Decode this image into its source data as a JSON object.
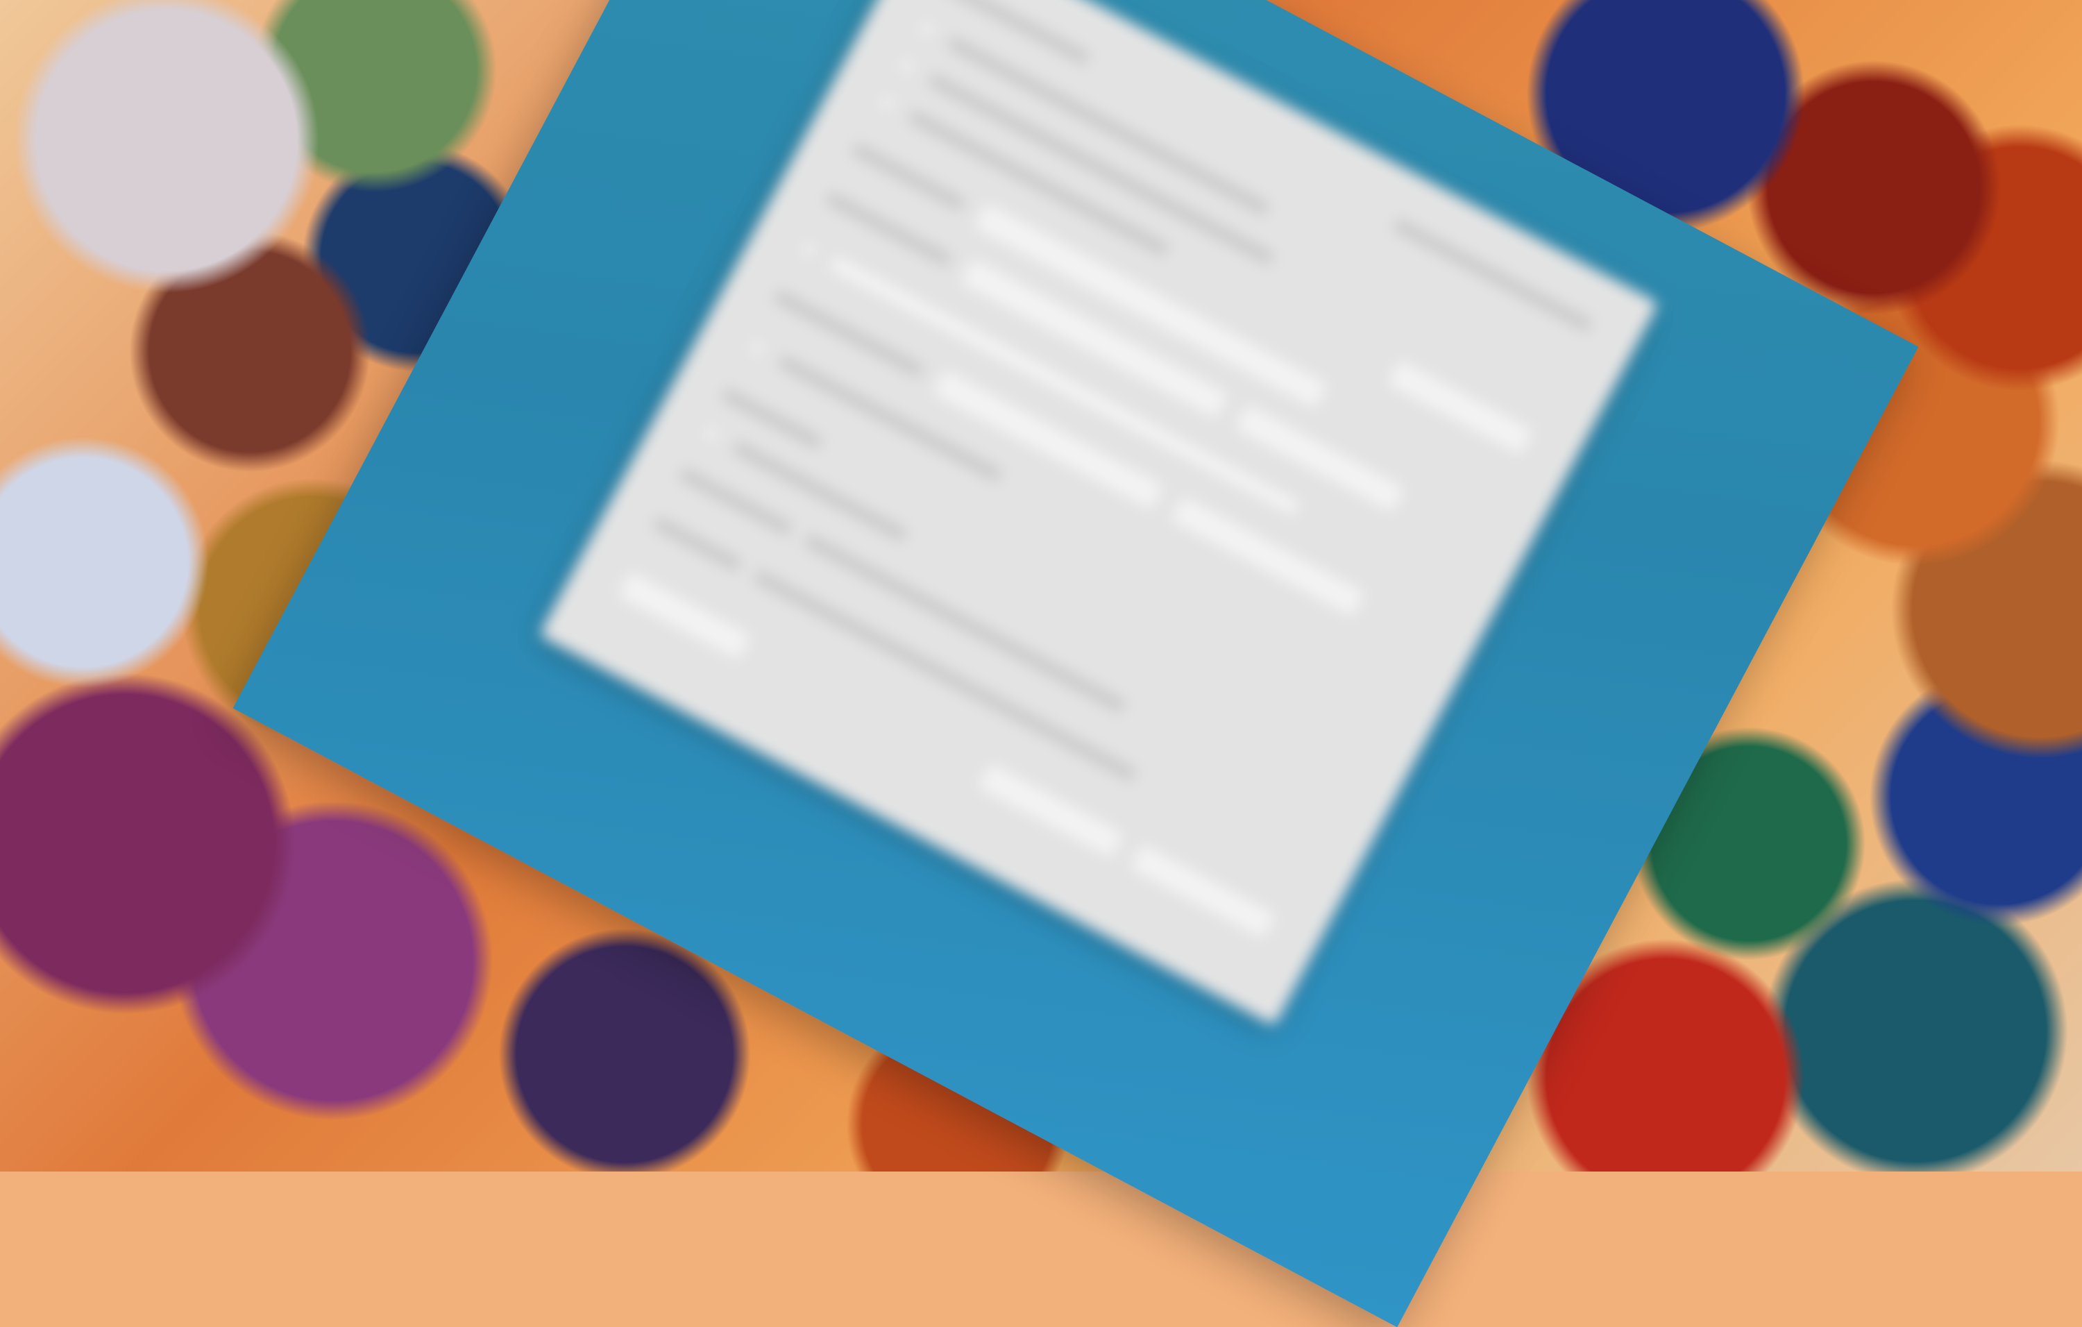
{
  "scene": {
    "type": "blurred-dialog-over-rotated-panel",
    "colors": {
      "panel": "#2f8fb0",
      "dialog": "#e3e3e3"
    },
    "dialog": {
      "rows": 14
    }
  }
}
